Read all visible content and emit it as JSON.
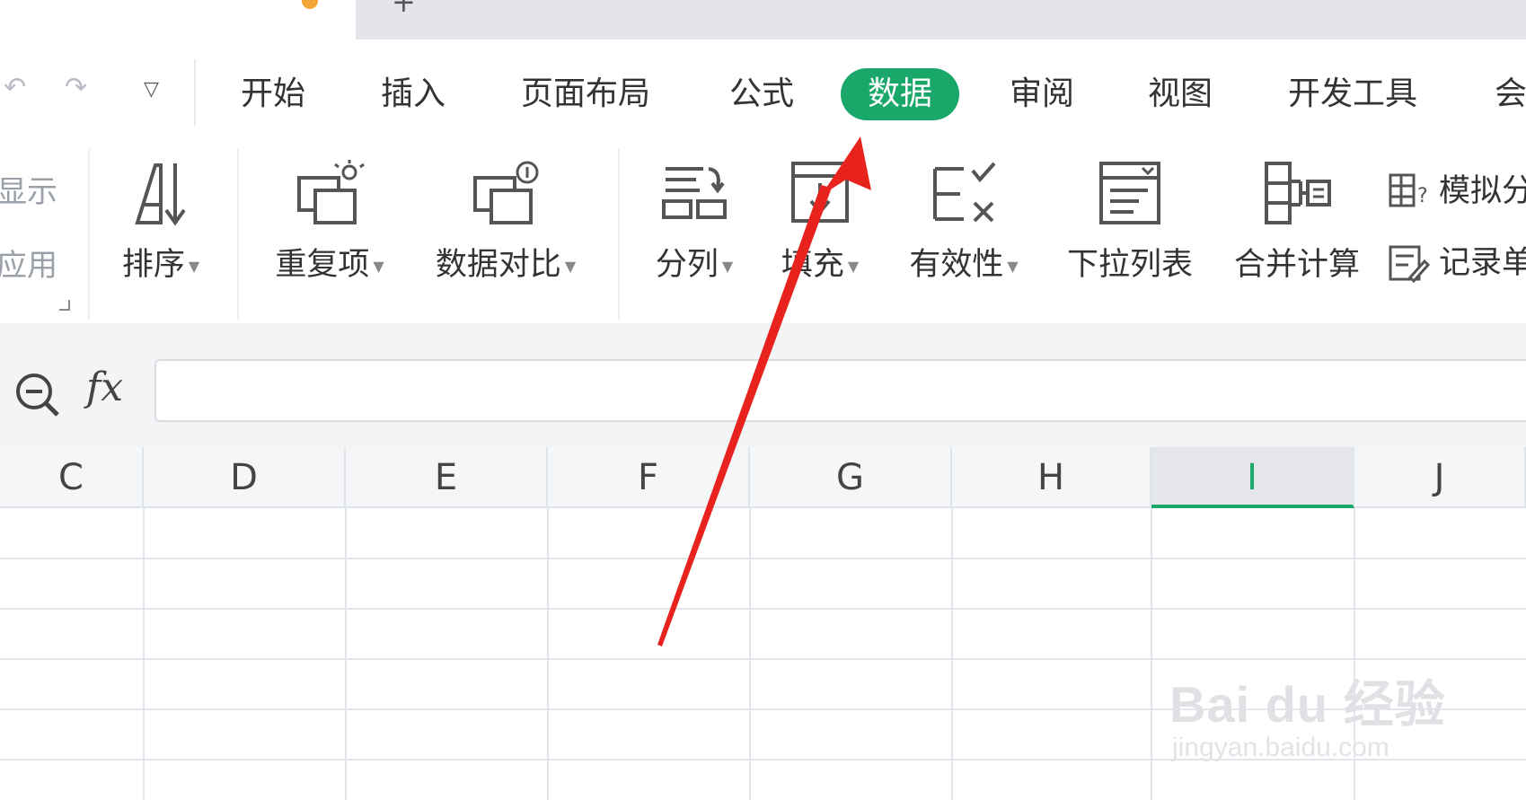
{
  "menu": {
    "tabs": [
      "开始",
      "插入",
      "页面布局",
      "公式",
      "数据",
      "审阅",
      "视图",
      "开发工具",
      "会"
    ],
    "active_tab": "数据"
  },
  "ribbon": {
    "left_partial": [
      "显示",
      "应用"
    ],
    "buttons": [
      "排序",
      "重复项",
      "数据对比",
      "分列",
      "填充",
      "有效性",
      "下拉列表",
      "合并计算"
    ],
    "side_items": [
      "模拟分",
      "记录单"
    ]
  },
  "formula_bar": {
    "fx_label": "fx",
    "value": ""
  },
  "columns": [
    "C",
    "D",
    "E",
    "F",
    "G",
    "H",
    "I",
    "J"
  ],
  "selected_column": "I",
  "watermark": {
    "text": "Bai du 经验",
    "sub": "jingyan.baidu.com"
  },
  "colors": {
    "accent": "#1aa86a",
    "arrow": "#e8231d"
  }
}
